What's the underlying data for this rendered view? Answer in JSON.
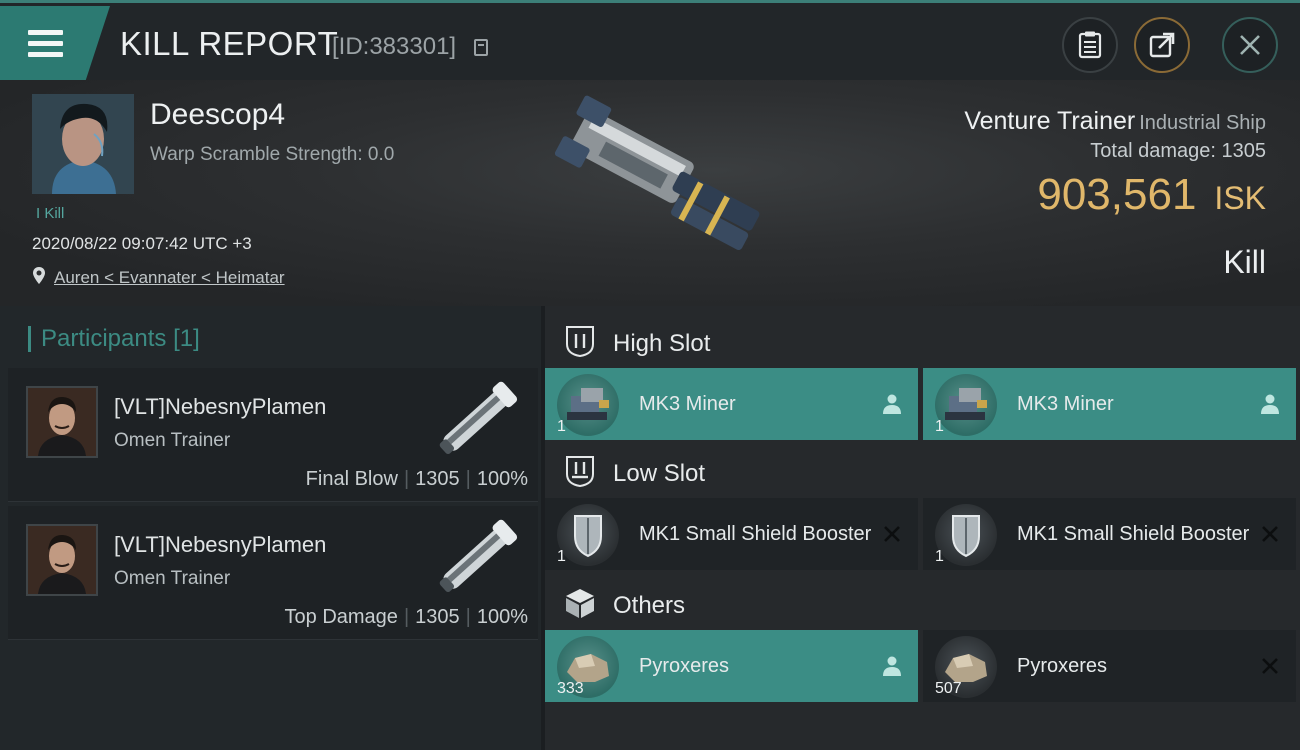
{
  "header": {
    "title": "KILL REPORT",
    "report_id": "[ID:383301]",
    "icons": {
      "menu": "menu-icon",
      "copy": "copy-icon",
      "clipboard": "clipboard-icon",
      "export": "export-icon",
      "close": "close-icon"
    }
  },
  "victim": {
    "name": "Deescop4",
    "warp_scramble": "Warp Scramble Strength: 0.0",
    "kill_tag": "I Kill",
    "datetime": "2020/08/22 09:07:42 UTC +3",
    "location": "Auren < Evannater < Heimatar"
  },
  "ship": {
    "name": "Venture Trainer",
    "class": "Industrial Ship",
    "total_damage_label": "Total damage:",
    "total_damage": "1305",
    "isk_value": "903,561",
    "isk_unit": "ISK",
    "result": "Kill"
  },
  "participants": {
    "heading": "Participants",
    "count": "[1]",
    "list": [
      {
        "name": "[VLT]NebesnyPlamen",
        "ship": "Omen Trainer",
        "tag": "Final Blow",
        "damage": "1305",
        "percent": "100%"
      },
      {
        "name": "[VLT]NebesnyPlamen",
        "ship": "Omen Trainer",
        "tag": "Top Damage",
        "damage": "1305",
        "percent": "100%"
      }
    ]
  },
  "slots": [
    {
      "label": "High Slot",
      "icon": "high-slot-icon",
      "items": [
        {
          "name": "MK3 Miner",
          "qty": "1",
          "state": "dropped"
        },
        {
          "name": "MK3 Miner",
          "qty": "1",
          "state": "dropped"
        }
      ]
    },
    {
      "label": "Low Slot",
      "icon": "low-slot-icon",
      "items": [
        {
          "name": "MK1 Small Shield Booster",
          "qty": "1",
          "state": "destroyed"
        },
        {
          "name": "MK1 Small Shield Booster",
          "qty": "1",
          "state": "destroyed"
        }
      ]
    },
    {
      "label": "Others",
      "icon": "cargo-icon",
      "items": [
        {
          "name": "Pyroxeres",
          "qty": "333",
          "state": "dropped"
        },
        {
          "name": "Pyroxeres",
          "qty": "507",
          "state": "destroyed"
        }
      ]
    }
  ],
  "colors": {
    "accent": "#3b8d85",
    "isk": "#e0b76a",
    "panel": "#1f2326"
  }
}
